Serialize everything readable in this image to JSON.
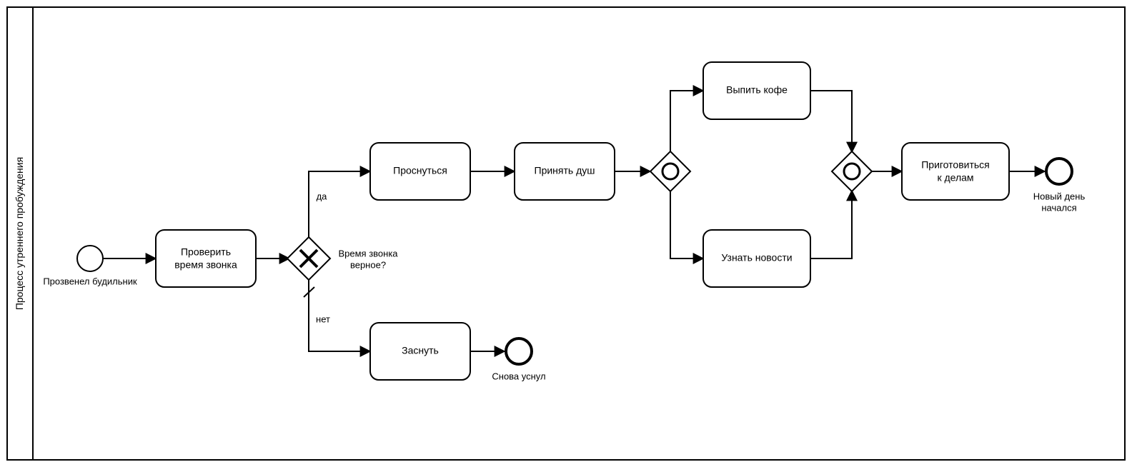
{
  "pool": {
    "title": "Процесс утреннего пробуждения"
  },
  "events": {
    "start": {
      "label": "Прозвенел будильник"
    },
    "end_sleep": {
      "label": "Снова уснул"
    },
    "end_day": {
      "label_l1": "Новый день",
      "label_l2": "начался"
    }
  },
  "tasks": {
    "check_time": {
      "label_l1": "Проверить",
      "label_l2": "время звонка"
    },
    "wake_up": {
      "label": "Проснуться"
    },
    "sleep": {
      "label": "Заснуть"
    },
    "shower": {
      "label": "Принять душ"
    },
    "coffee": {
      "label": "Выпить кофе"
    },
    "news": {
      "label": "Узнать новости"
    },
    "prepare": {
      "label_l1": "Приготовиться",
      "label_l2": "к делам"
    }
  },
  "gateways": {
    "exclusive": {
      "question_l1": "Время звонка",
      "question_l2": "верное?",
      "yes": "да",
      "no": "нет"
    }
  }
}
